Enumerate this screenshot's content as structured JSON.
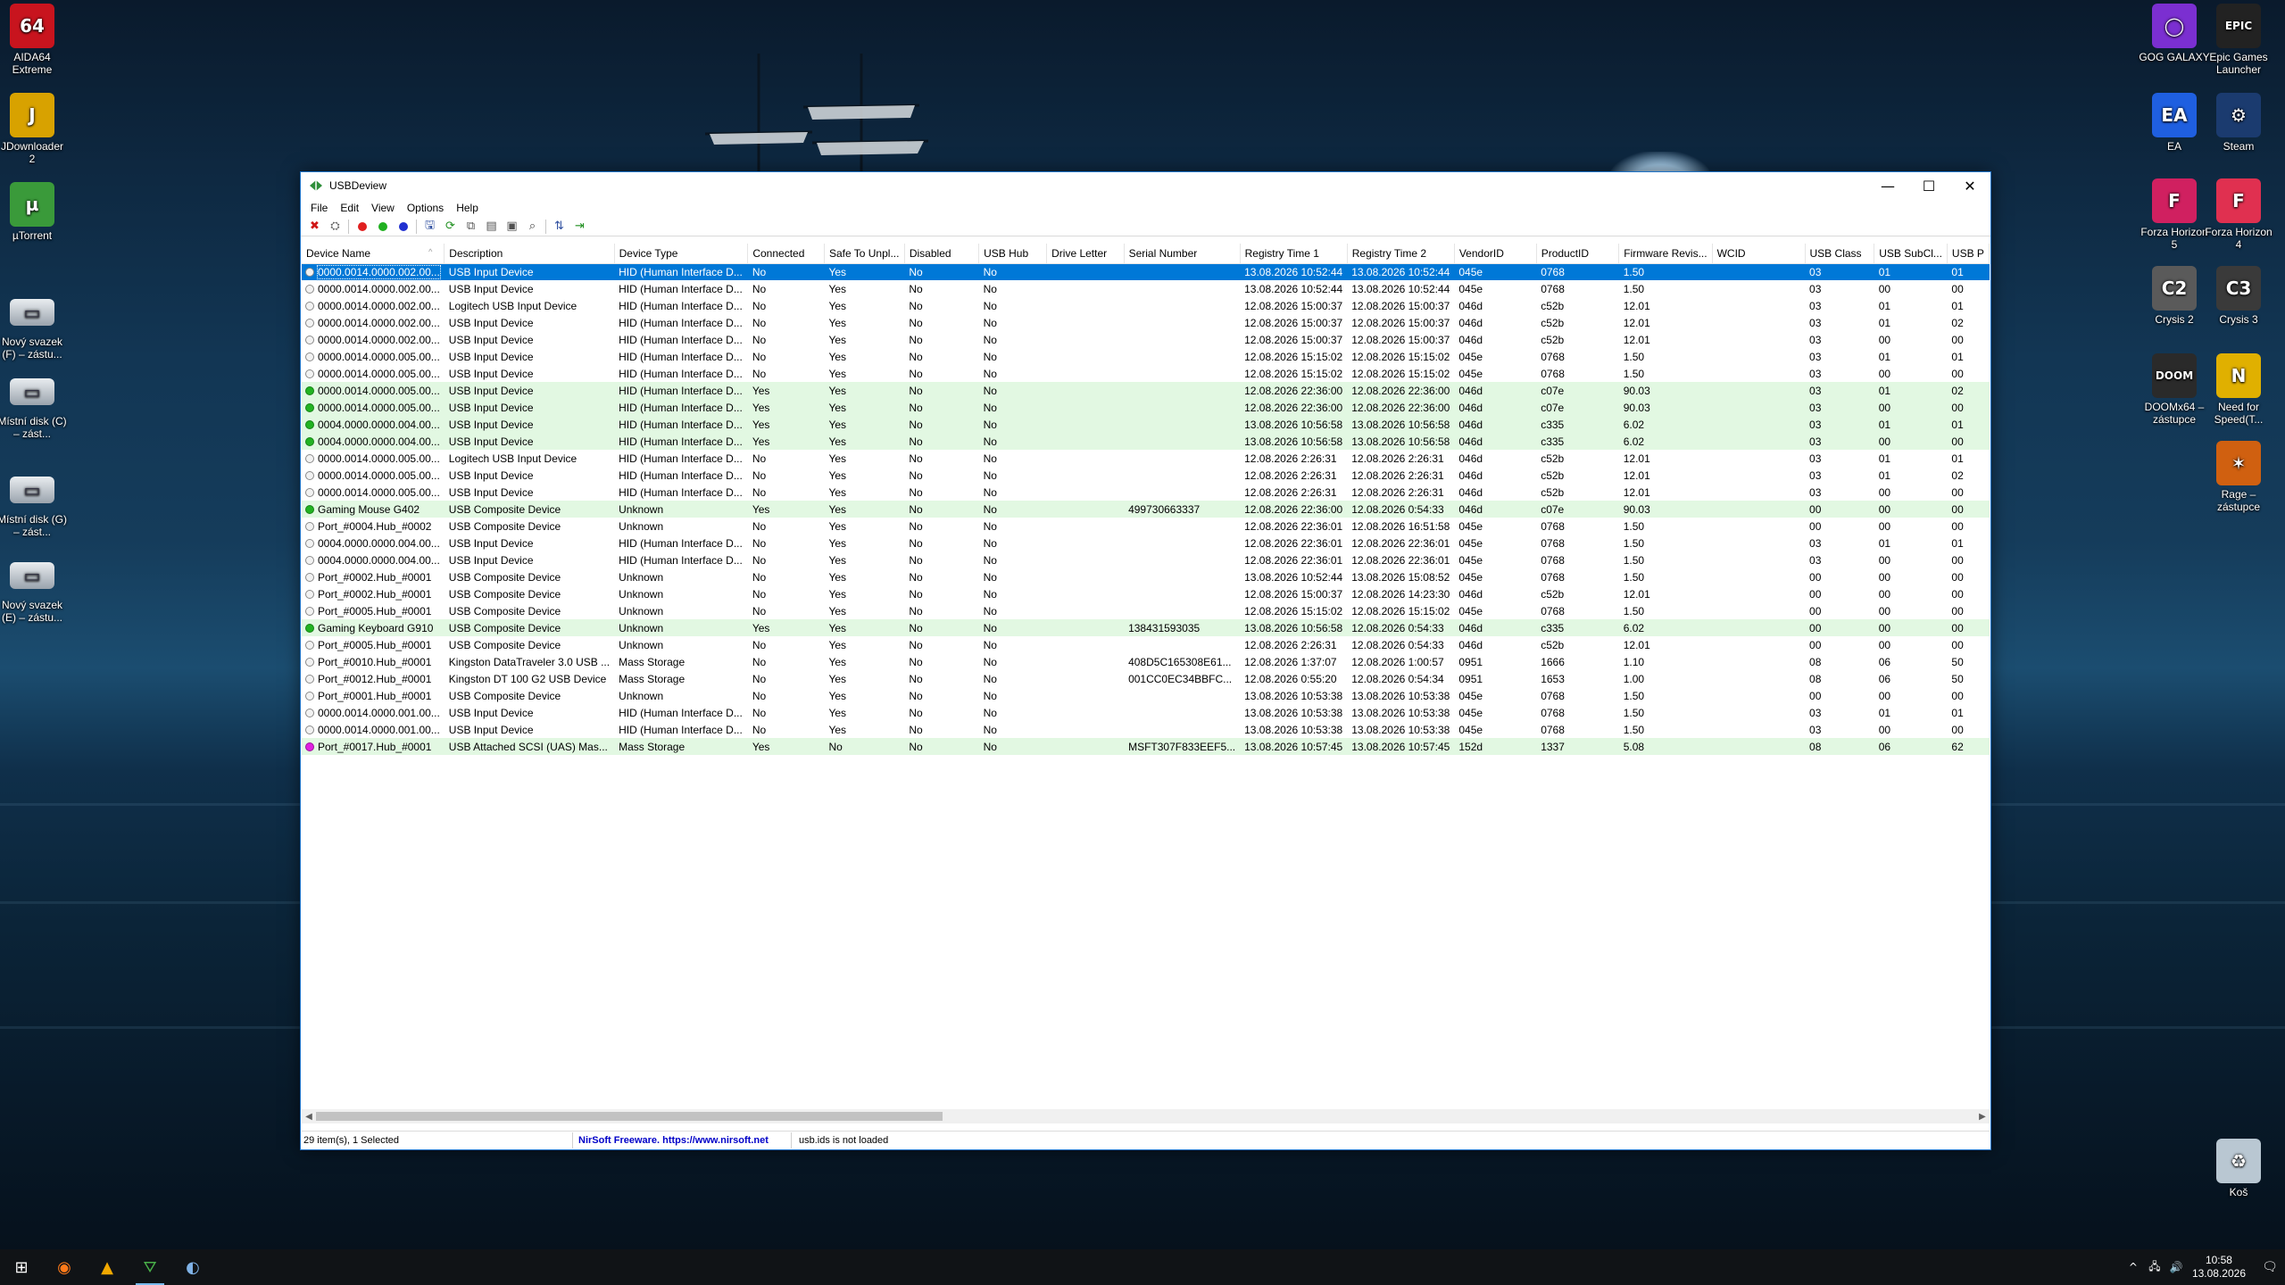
{
  "desktop": {
    "left_icons": [
      {
        "label": "AIDA64 Extreme",
        "glyph": "64",
        "color": "#c8141e"
      },
      {
        "label": "JDownloader 2",
        "glyph": "J",
        "color": "#d8a200"
      },
      {
        "label": "µTorrent",
        "glyph": "µ",
        "color": "#3a9a3a"
      },
      {
        "label": "Nový svazek (F) – zástu...",
        "glyph": "▭",
        "color": "#9aa3ad"
      },
      {
        "label": "Místní disk (C) – zást...",
        "glyph": "▭",
        "color": "#9aa3ad"
      },
      {
        "label": "Místní disk (G) – zást...",
        "glyph": "▭",
        "color": "#9aa3ad"
      },
      {
        "label": "Nový svazek (E) – zástu...",
        "glyph": "▭",
        "color": "#9aa3ad"
      }
    ],
    "right_icons": [
      {
        "label": "GOG GALAXY",
        "glyph": "◯",
        "color": "#7b2fd1"
      },
      {
        "label": "Epic Games Launcher",
        "glyph": "EPIC",
        "color": "#222222"
      },
      {
        "label": "EA",
        "glyph": "EA",
        "color": "#1f5fe0"
      },
      {
        "label": "Steam",
        "glyph": "⚙",
        "color": "#1b3b6f"
      },
      {
        "label": "Forza Horizon 5",
        "glyph": "F",
        "color": "#d02060"
      },
      {
        "label": "Forza Horizon 4",
        "glyph": "F",
        "color": "#e03050"
      },
      {
        "label": "Crysis 2",
        "glyph": "C2",
        "color": "#5a5a5a"
      },
      {
        "label": "Crysis 3",
        "glyph": "C3",
        "color": "#3a3a3a"
      },
      {
        "label": "DOOMx64 – zástupce",
        "glyph": "DOOM",
        "color": "#2a2a2a"
      },
      {
        "label": "Need for Speed(T...",
        "glyph": "N",
        "color": "#e0b000"
      },
      {
        "label": "Rage – zástupce",
        "glyph": "✶",
        "color": "#d06010"
      },
      {
        "label": "Koš",
        "glyph": "♻",
        "color": "#b9c7d2"
      }
    ]
  },
  "window": {
    "title": "USBDeview",
    "controls": {
      "minimize": "—",
      "maximize": "☐",
      "close": "✕"
    },
    "menu": [
      "File",
      "Edit",
      "View",
      "Options",
      "Help"
    ],
    "toolbar": [
      {
        "name": "disconnect-icon",
        "glyph": "✖",
        "color": "#d01818"
      },
      {
        "name": "uninstall-icon",
        "glyph": "⛭",
        "color": "#606060"
      },
      {
        "name": "disable-dot-icon",
        "glyph": "dot",
        "color": "#e02020"
      },
      {
        "name": "enable-dot-icon",
        "glyph": "dot",
        "color": "#20b020"
      },
      {
        "name": "dot-blue-icon",
        "glyph": "dot",
        "color": "#2030d0"
      },
      {
        "name": "save-icon",
        "glyph": "🖫",
        "color": "#3050a0"
      },
      {
        "name": "refresh-icon",
        "glyph": "⟳",
        "color": "#209020"
      },
      {
        "name": "copy-icon",
        "glyph": "⧉",
        "color": "#505050"
      },
      {
        "name": "report-icon",
        "glyph": "▤",
        "color": "#505050"
      },
      {
        "name": "properties-icon",
        "glyph": "▣",
        "color": "#505050"
      },
      {
        "name": "find-icon",
        "glyph": "⌕",
        "color": "#404040"
      },
      {
        "name": "sort-icon",
        "glyph": "⇅",
        "color": "#3050a0"
      },
      {
        "name": "exit-icon",
        "glyph": "⇥",
        "color": "#209020"
      }
    ],
    "columns": [
      "Device Name",
      "Description",
      "Device Type",
      "Connected",
      "Safe To Unpl...",
      "Disabled",
      "USB Hub",
      "Drive Letter",
      "Serial Number",
      "Registry Time 1",
      "Registry Time 2",
      "VendorID",
      "ProductID",
      "Firmware Revis...",
      "WCID",
      "USB Class",
      "USB SubCl...",
      "USB P"
    ],
    "sort_indicator": "^",
    "rows": [
      {
        "status": "sel",
        "cells": [
          "0000.0014.0000.002.00...",
          "USB Input Device",
          "HID (Human Interface D...",
          "No",
          "Yes",
          "No",
          "No",
          "",
          "",
          "13.08.2026 10:52:44",
          "13.08.2026 10:52:44",
          "045e",
          "0768",
          "1.50",
          "",
          "03",
          "01",
          "01"
        ]
      },
      {
        "status": "grey",
        "cells": [
          "0000.0014.0000.002.00...",
          "USB Input Device",
          "HID (Human Interface D...",
          "No",
          "Yes",
          "No",
          "No",
          "",
          "",
          "13.08.2026 10:52:44",
          "13.08.2026 10:52:44",
          "045e",
          "0768",
          "1.50",
          "",
          "03",
          "00",
          "00"
        ]
      },
      {
        "status": "grey",
        "cells": [
          "0000.0014.0000.002.00...",
          "Logitech USB Input Device",
          "HID (Human Interface D...",
          "No",
          "Yes",
          "No",
          "No",
          "",
          "",
          "12.08.2026 15:00:37",
          "12.08.2026 15:00:37",
          "046d",
          "c52b",
          "12.01",
          "",
          "03",
          "01",
          "01"
        ]
      },
      {
        "status": "grey",
        "cells": [
          "0000.0014.0000.002.00...",
          "USB Input Device",
          "HID (Human Interface D...",
          "No",
          "Yes",
          "No",
          "No",
          "",
          "",
          "12.08.2026 15:00:37",
          "12.08.2026 15:00:37",
          "046d",
          "c52b",
          "12.01",
          "",
          "03",
          "01",
          "02"
        ]
      },
      {
        "status": "grey",
        "cells": [
          "0000.0014.0000.002.00...",
          "USB Input Device",
          "HID (Human Interface D...",
          "No",
          "Yes",
          "No",
          "No",
          "",
          "",
          "12.08.2026 15:00:37",
          "12.08.2026 15:00:37",
          "046d",
          "c52b",
          "12.01",
          "",
          "03",
          "00",
          "00"
        ]
      },
      {
        "status": "grey",
        "cells": [
          "0000.0014.0000.005.00...",
          "USB Input Device",
          "HID (Human Interface D...",
          "No",
          "Yes",
          "No",
          "No",
          "",
          "",
          "12.08.2026 15:15:02",
          "12.08.2026 15:15:02",
          "045e",
          "0768",
          "1.50",
          "",
          "03",
          "01",
          "01"
        ]
      },
      {
        "status": "grey",
        "cells": [
          "0000.0014.0000.005.00...",
          "USB Input Device",
          "HID (Human Interface D...",
          "No",
          "Yes",
          "No",
          "No",
          "",
          "",
          "12.08.2026 15:15:02",
          "12.08.2026 15:15:02",
          "045e",
          "0768",
          "1.50",
          "",
          "03",
          "00",
          "00"
        ]
      },
      {
        "status": "green",
        "cells": [
          "0000.0014.0000.005.00...",
          "USB Input Device",
          "HID (Human Interface D...",
          "Yes",
          "Yes",
          "No",
          "No",
          "",
          "",
          "12.08.2026 22:36:00",
          "12.08.2026 22:36:00",
          "046d",
          "c07e",
          "90.03",
          "",
          "03",
          "01",
          "02"
        ]
      },
      {
        "status": "green",
        "cells": [
          "0000.0014.0000.005.00...",
          "USB Input Device",
          "HID (Human Interface D...",
          "Yes",
          "Yes",
          "No",
          "No",
          "",
          "",
          "12.08.2026 22:36:00",
          "12.08.2026 22:36:00",
          "046d",
          "c07e",
          "90.03",
          "",
          "03",
          "00",
          "00"
        ]
      },
      {
        "status": "green",
        "cells": [
          "0004.0000.0000.004.00...",
          "USB Input Device",
          "HID (Human Interface D...",
          "Yes",
          "Yes",
          "No",
          "No",
          "",
          "",
          "13.08.2026 10:56:58",
          "13.08.2026 10:56:58",
          "046d",
          "c335",
          "6.02",
          "",
          "03",
          "01",
          "01"
        ]
      },
      {
        "status": "green",
        "cells": [
          "0004.0000.0000.004.00...",
          "USB Input Device",
          "HID (Human Interface D...",
          "Yes",
          "Yes",
          "No",
          "No",
          "",
          "",
          "13.08.2026 10:56:58",
          "13.08.2026 10:56:58",
          "046d",
          "c335",
          "6.02",
          "",
          "03",
          "00",
          "00"
        ]
      },
      {
        "status": "grey",
        "cells": [
          "0000.0014.0000.005.00...",
          "Logitech USB Input Device",
          "HID (Human Interface D...",
          "No",
          "Yes",
          "No",
          "No",
          "",
          "",
          "12.08.2026 2:26:31",
          "12.08.2026 2:26:31",
          "046d",
          "c52b",
          "12.01",
          "",
          "03",
          "01",
          "01"
        ]
      },
      {
        "status": "grey",
        "cells": [
          "0000.0014.0000.005.00...",
          "USB Input Device",
          "HID (Human Interface D...",
          "No",
          "Yes",
          "No",
          "No",
          "",
          "",
          "12.08.2026 2:26:31",
          "12.08.2026 2:26:31",
          "046d",
          "c52b",
          "12.01",
          "",
          "03",
          "01",
          "02"
        ]
      },
      {
        "status": "grey",
        "cells": [
          "0000.0014.0000.005.00...",
          "USB Input Device",
          "HID (Human Interface D...",
          "No",
          "Yes",
          "No",
          "No",
          "",
          "",
          "12.08.2026 2:26:31",
          "12.08.2026 2:26:31",
          "046d",
          "c52b",
          "12.01",
          "",
          "03",
          "00",
          "00"
        ]
      },
      {
        "status": "green",
        "cells": [
          "Gaming Mouse G402",
          "USB Composite Device",
          "Unknown",
          "Yes",
          "Yes",
          "No",
          "No",
          "",
          "499730663337",
          "12.08.2026 22:36:00",
          "12.08.2026 0:54:33",
          "046d",
          "c07e",
          "90.03",
          "",
          "00",
          "00",
          "00"
        ]
      },
      {
        "status": "grey",
        "cells": [
          "Port_#0004.Hub_#0002",
          "USB Composite Device",
          "Unknown",
          "No",
          "Yes",
          "No",
          "No",
          "",
          "",
          "12.08.2026 22:36:01",
          "12.08.2026 16:51:58",
          "045e",
          "0768",
          "1.50",
          "",
          "00",
          "00",
          "00"
        ]
      },
      {
        "status": "grey",
        "cells": [
          "0004.0000.0000.004.00...",
          "USB Input Device",
          "HID (Human Interface D...",
          "No",
          "Yes",
          "No",
          "No",
          "",
          "",
          "12.08.2026 22:36:01",
          "12.08.2026 22:36:01",
          "045e",
          "0768",
          "1.50",
          "",
          "03",
          "01",
          "01"
        ]
      },
      {
        "status": "grey",
        "cells": [
          "0004.0000.0000.004.00...",
          "USB Input Device",
          "HID (Human Interface D...",
          "No",
          "Yes",
          "No",
          "No",
          "",
          "",
          "12.08.2026 22:36:01",
          "12.08.2026 22:36:01",
          "045e",
          "0768",
          "1.50",
          "",
          "03",
          "00",
          "00"
        ]
      },
      {
        "status": "grey",
        "cells": [
          "Port_#0002.Hub_#0001",
          "USB Composite Device",
          "Unknown",
          "No",
          "Yes",
          "No",
          "No",
          "",
          "",
          "13.08.2026 10:52:44",
          "13.08.2026 15:08:52",
          "045e",
          "0768",
          "1.50",
          "",
          "00",
          "00",
          "00"
        ]
      },
      {
        "status": "grey",
        "cells": [
          "Port_#0002.Hub_#0001",
          "USB Composite Device",
          "Unknown",
          "No",
          "Yes",
          "No",
          "No",
          "",
          "",
          "12.08.2026 15:00:37",
          "12.08.2026 14:23:30",
          "046d",
          "c52b",
          "12.01",
          "",
          "00",
          "00",
          "00"
        ]
      },
      {
        "status": "grey",
        "cells": [
          "Port_#0005.Hub_#0001",
          "USB Composite Device",
          "Unknown",
          "No",
          "Yes",
          "No",
          "No",
          "",
          "",
          "12.08.2026 15:15:02",
          "12.08.2026 15:15:02",
          "045e",
          "0768",
          "1.50",
          "",
          "00",
          "00",
          "00"
        ]
      },
      {
        "status": "green",
        "cells": [
          "Gaming Keyboard G910",
          "USB Composite Device",
          "Unknown",
          "Yes",
          "Yes",
          "No",
          "No",
          "",
          "138431593035",
          "13.08.2026 10:56:58",
          "12.08.2026 0:54:33",
          "046d",
          "c335",
          "6.02",
          "",
          "00",
          "00",
          "00"
        ]
      },
      {
        "status": "grey",
        "cells": [
          "Port_#0005.Hub_#0001",
          "USB Composite Device",
          "Unknown",
          "No",
          "Yes",
          "No",
          "No",
          "",
          "",
          "12.08.2026 2:26:31",
          "12.08.2026 0:54:33",
          "046d",
          "c52b",
          "12.01",
          "",
          "00",
          "00",
          "00"
        ]
      },
      {
        "status": "grey",
        "cells": [
          "Port_#0010.Hub_#0001",
          "Kingston DataTraveler 3.0 USB ...",
          "Mass Storage",
          "No",
          "Yes",
          "No",
          "No",
          "",
          "408D5C165308E61...",
          "12.08.2026 1:37:07",
          "12.08.2026 1:00:57",
          "0951",
          "1666",
          "1.10",
          "",
          "08",
          "06",
          "50"
        ]
      },
      {
        "status": "grey",
        "cells": [
          "Port_#0012.Hub_#0001",
          "Kingston DT 100 G2 USB Device",
          "Mass Storage",
          "No",
          "Yes",
          "No",
          "No",
          "",
          "001CC0EC34BBFC...",
          "12.08.2026 0:55:20",
          "12.08.2026 0:54:34",
          "0951",
          "1653",
          "1.00",
          "",
          "08",
          "06",
          "50"
        ]
      },
      {
        "status": "grey",
        "cells": [
          "Port_#0001.Hub_#0001",
          "USB Composite Device",
          "Unknown",
          "No",
          "Yes",
          "No",
          "No",
          "",
          "",
          "13.08.2026 10:53:38",
          "13.08.2026 10:53:38",
          "045e",
          "0768",
          "1.50",
          "",
          "00",
          "00",
          "00"
        ]
      },
      {
        "status": "grey",
        "cells": [
          "0000.0014.0000.001.00...",
          "USB Input Device",
          "HID (Human Interface D...",
          "No",
          "Yes",
          "No",
          "No",
          "",
          "",
          "13.08.2026 10:53:38",
          "13.08.2026 10:53:38",
          "045e",
          "0768",
          "1.50",
          "",
          "03",
          "01",
          "01"
        ]
      },
      {
        "status": "grey",
        "cells": [
          "0000.0014.0000.001.00...",
          "USB Input Device",
          "HID (Human Interface D...",
          "No",
          "Yes",
          "No",
          "No",
          "",
          "",
          "13.08.2026 10:53:38",
          "13.08.2026 10:53:38",
          "045e",
          "0768",
          "1.50",
          "",
          "03",
          "00",
          "00"
        ]
      },
      {
        "status": "pink",
        "cells": [
          "Port_#0017.Hub_#0001",
          "USB Attached SCSI (UAS) Mas...",
          "Mass Storage",
          "Yes",
          "No",
          "No",
          "No",
          "",
          "MSFT307F833EEF5...",
          "13.08.2026 10:57:45",
          "13.08.2026 10:57:45",
          "152d",
          "1337",
          "5.08",
          "",
          "08",
          "06",
          "62"
        ]
      }
    ],
    "status": {
      "count": "29 item(s), 1 Selected",
      "freeware": "NirSoft Freeware.  https://www.nirsoft.net",
      "usbids": "usb.ids is not loaded"
    }
  },
  "taskbar": {
    "apps": [
      {
        "name": "windows-start-icon",
        "glyph": "⊞"
      },
      {
        "name": "firefox-icon",
        "glyph": "◉"
      },
      {
        "name": "avast-icon",
        "glyph": "▲"
      },
      {
        "name": "usbdeview-icon",
        "glyph": "⛛"
      },
      {
        "name": "hwinfo-icon",
        "glyph": "◐"
      }
    ],
    "tray": [
      "^",
      "🖧",
      "🔊"
    ],
    "time": "10:58",
    "date": "13.08.2026",
    "notify": "🗨"
  }
}
